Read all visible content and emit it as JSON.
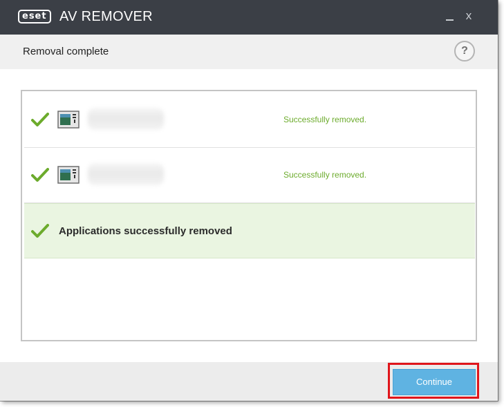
{
  "window": {
    "brand": "eset",
    "title": "AV REMOVER",
    "minimize_icon": "minimize-icon",
    "close_label": "x"
  },
  "subheader": {
    "title": "Removal complete",
    "help_label": "?"
  },
  "results": [
    {
      "icon": "checkmark-icon",
      "app_icon": "application-window-icon",
      "status": "Successfully removed."
    },
    {
      "icon": "checkmark-icon",
      "app_icon": "application-window-icon",
      "status": "Successfully removed."
    }
  ],
  "summary": {
    "icon": "checkmark-icon",
    "text": "Applications successfully removed"
  },
  "footer": {
    "continue_label": "Continue"
  },
  "colors": {
    "titlebar": "#3b3f46",
    "success_green": "#6cab2c",
    "summary_bg": "#eaf5e1",
    "button_blue": "#5fb3e2",
    "highlight_red": "#e0151b"
  }
}
